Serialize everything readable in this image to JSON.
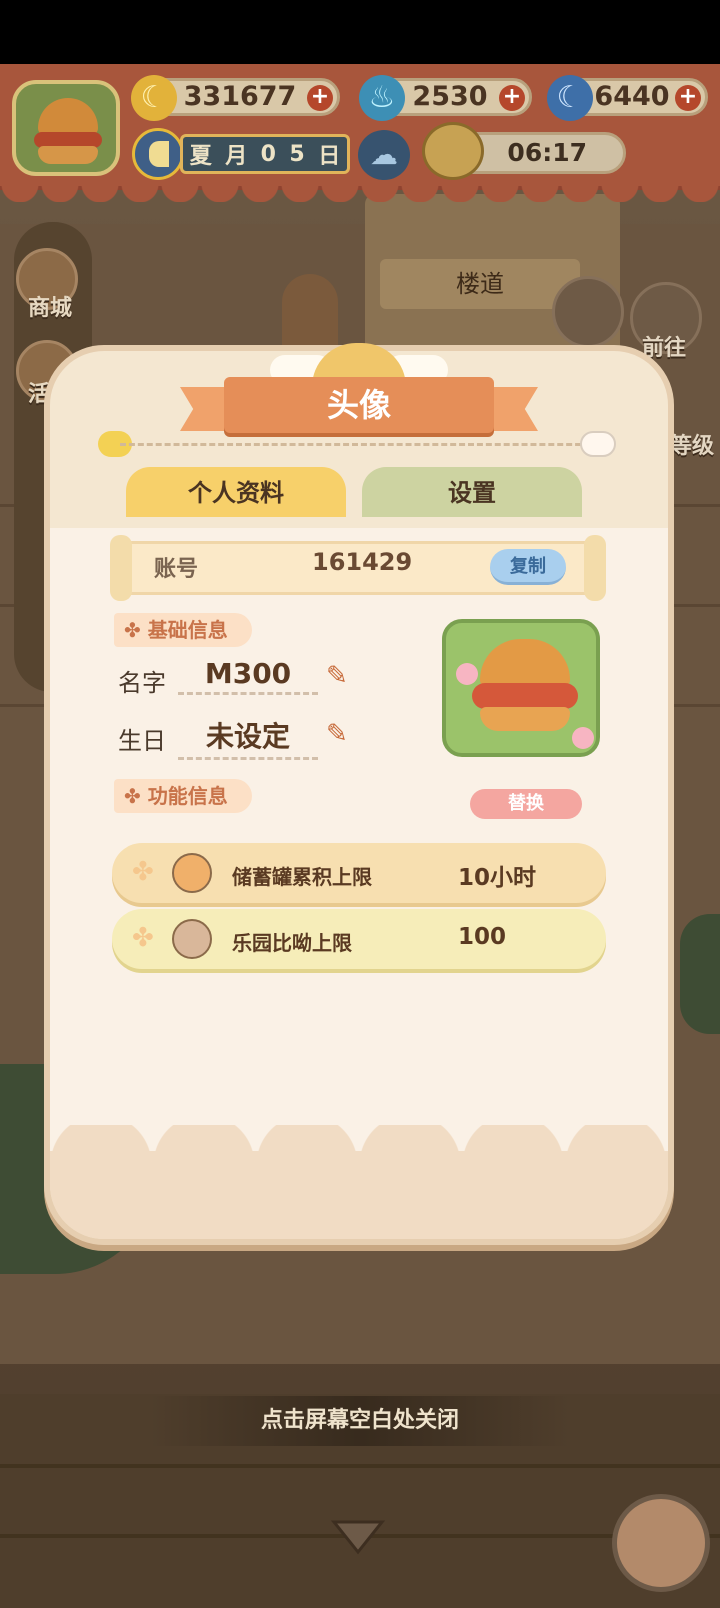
{
  "hud": {
    "bananas": "331677",
    "flames": "2530",
    "blue_bananas": "6440",
    "date": {
      "season": "夏",
      "month_char": "月",
      "day_tens": "0",
      "day_ones": "5",
      "day_char": "日"
    },
    "timer": "06:17"
  },
  "side_menu": {
    "shop": "商城",
    "activity": "活",
    "level": "等级",
    "go": "前往"
  },
  "background": {
    "door_sign": "楼道"
  },
  "modal": {
    "title": "头像",
    "tabs": {
      "profile": "个人资料",
      "settings": "设置"
    },
    "account": {
      "label": "账号",
      "value": "161429",
      "copy": "复制"
    },
    "basic_section": "基础信息",
    "name": {
      "label": "名字",
      "value": "M300"
    },
    "birthday": {
      "label": "生日",
      "value": "未设定"
    },
    "replace": "替换",
    "feature_section": "功能信息",
    "features": [
      {
        "name": "储蓄罐累积上限",
        "value": "10小时"
      },
      {
        "name": "乐园比呦上限",
        "value": "100"
      }
    ]
  },
  "close_hint": "点击屏幕空白处关闭",
  "colors": {
    "accent": "#e58e58",
    "banner": "#a8563c",
    "modal_bg": "#faf1e6",
    "tab_active": "#f7d06a",
    "tab_inactive": "#cdd3a1"
  },
  "icons": [
    "banana-icon",
    "flame-icon",
    "blue-banana-icon",
    "plus-icon",
    "season-icon",
    "weather-icon",
    "timer-icon",
    "pencil-icon",
    "clover-icon",
    "piggy-bank-icon",
    "monkey-icon",
    "down-arrow-icon",
    "yarn-ball-icon"
  ]
}
